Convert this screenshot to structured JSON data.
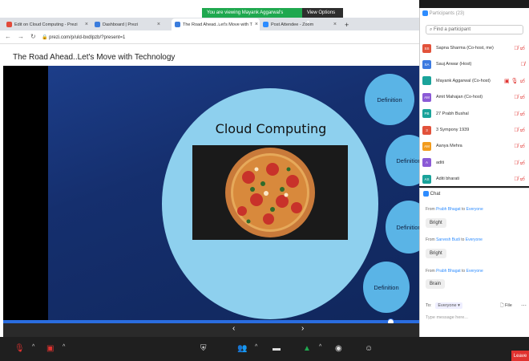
{
  "zoom_banner": {
    "viewing": "You are viewing Mayank Aggarwal's screen",
    "view_options": "View Options ▾"
  },
  "tabs": [
    {
      "label": "Edit on Cloud Computing - Prezi",
      "color": "#e24a3a"
    },
    {
      "label": "Dashboard | Prezi",
      "color": "#3b7ddd"
    },
    {
      "label": "The Road Ahead..Let's Move with T",
      "color": "#3b7ddd"
    },
    {
      "label": "Post Attendee - Zoom",
      "color": "#2d8cff"
    }
  ],
  "address": {
    "url": "prezi.com/p/uld-bxdlpzb/?present=1"
  },
  "prezi": {
    "title": "The Road Ahead..Let's Move with Technology",
    "slide_heading": "Cloud Computing",
    "definitions": [
      "Definition",
      "Definition",
      "Definition",
      "Definition"
    ],
    "prev": "‹",
    "next": "›"
  },
  "participants": {
    "header": "Participants (23)",
    "search_placeholder": "Find a participant",
    "list": [
      {
        "initials": "SS",
        "name": "Sapna Sharma (Co-host, me)",
        "color": "#e2523b",
        "icons": "🎙̸ ▭̸"
      },
      {
        "initials": "SA",
        "name": "Sauj Anwar (Host)",
        "color": "#3c7ae0",
        "icons": "🎙̸"
      },
      {
        "initials": "",
        "name": "Mayank Aggarwal (Co-host)",
        "color": "#1aa39a",
        "icons": "▣ 🎙 ▭̸"
      },
      {
        "initials": "AM",
        "name": "Amit Mahajan (Co-host)",
        "color": "#8b5ad6",
        "icons": "🎙̸ ▭̸"
      },
      {
        "initials": "PB",
        "name": "27 Prabh Bushal",
        "color": "#1aa39a",
        "icons": "🎙̸ ▭̸"
      },
      {
        "initials": "3",
        "name": "3 Sympony 1939",
        "color": "#e2523b",
        "icons": "🎙̸ ▭̸"
      },
      {
        "initials": "AM",
        "name": "Aanya Mehra",
        "color": "#f29b1c",
        "icons": "🎙̸ ▭̸"
      },
      {
        "initials": "A",
        "name": "aditi",
        "color": "#8b5ad6",
        "icons": "🎙̸ ▭̸"
      },
      {
        "initials": "AS",
        "name": "Aditi bharati",
        "color": "#1aa39a",
        "icons": "🎙̸ ▭̸"
      }
    ]
  },
  "chat": {
    "title": "Chat",
    "messages": [
      {
        "from_prefix": "From",
        "from": "Prabh Bhagat",
        "to_prefix": "to",
        "to": "Everyone",
        "text": "Bright"
      },
      {
        "from_prefix": "From",
        "from": "Sarvesh Budi",
        "to_prefix": "to",
        "to": "Everyone",
        "text": "Bright"
      },
      {
        "from_prefix": "From",
        "from": "Prabh Bhagat",
        "to_prefix": "to",
        "to": "Everyone",
        "text": "Brain"
      }
    ],
    "to_label": "To:",
    "to_value": "Everyone ▾",
    "file": "File",
    "input_placeholder": "Type message here..."
  },
  "toolbar": {
    "leave": "Leave"
  }
}
